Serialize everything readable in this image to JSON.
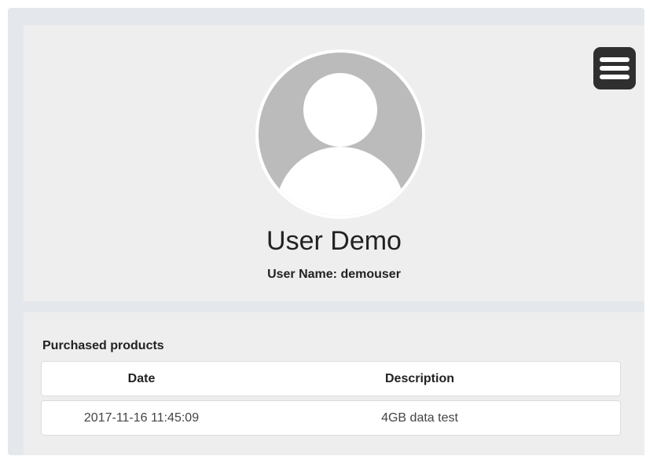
{
  "profile": {
    "full_name": "User Demo",
    "username_label": "User Name: demouser",
    "avatar_icon": "user-avatar-icon",
    "menu_icon": "hamburger-menu-icon"
  },
  "products": {
    "title": "Purchased products",
    "columns": [
      "Date",
      "Description"
    ],
    "rows": [
      [
        "2017-11-16 11:45:09",
        "4GB data test"
      ]
    ]
  },
  "colors": {
    "background": "#e4e8ed",
    "card": "#eeeeee",
    "avatar_fill": "#bbbbbb",
    "menu_button": "#2f2f2f"
  }
}
